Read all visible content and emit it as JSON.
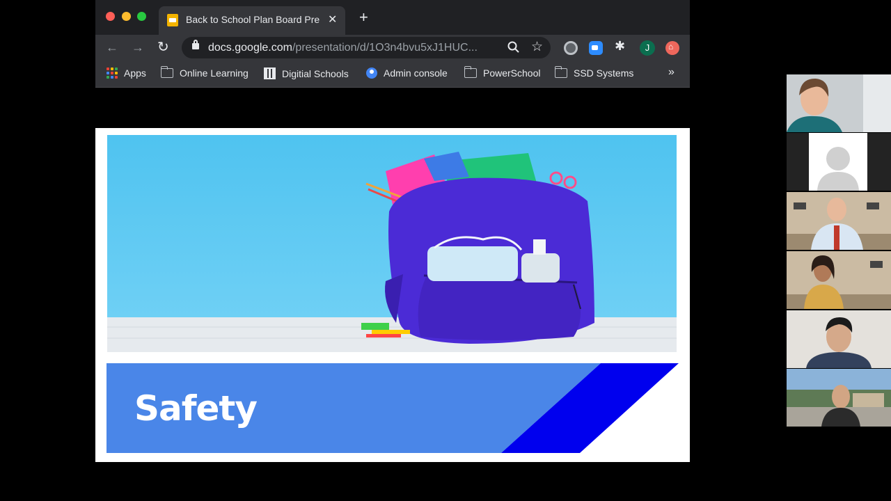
{
  "browser": {
    "tab": {
      "title": "Back to School Plan Board Pre",
      "close": "✕"
    },
    "new_tab": "+",
    "nav": {
      "back": "←",
      "forward": "→",
      "reload": "↻"
    },
    "address": {
      "host": "docs.google.com",
      "path": "/presentation/d/1O3n4bvu5xJ1HUC..."
    },
    "profile_initial": "J",
    "bookmarks": [
      {
        "label": "Apps",
        "icon": "apps-grid-icon"
      },
      {
        "label": "Online Learning",
        "icon": "folder-icon"
      },
      {
        "label": "Digitial Schools",
        "icon": "qr-icon"
      },
      {
        "label": "Admin console",
        "icon": "admin-icon"
      },
      {
        "label": "PowerSchool",
        "icon": "folder-icon"
      },
      {
        "label": "SSD Systems",
        "icon": "folder-icon"
      }
    ],
    "bookmarks_more": "»"
  },
  "slide": {
    "title": "Safety",
    "colors": {
      "sky": "#5cc8f2",
      "banner": "#4a86e8",
      "stripe": "#0000ee",
      "backpack": "#4b2bd6"
    }
  },
  "participants": [
    {
      "name": "participant-1",
      "kind": "video"
    },
    {
      "name": "participant-2",
      "kind": "avatar"
    },
    {
      "name": "participant-3",
      "kind": "video"
    },
    {
      "name": "participant-4",
      "kind": "video"
    },
    {
      "name": "participant-5",
      "kind": "video"
    },
    {
      "name": "participant-6",
      "kind": "video"
    }
  ]
}
